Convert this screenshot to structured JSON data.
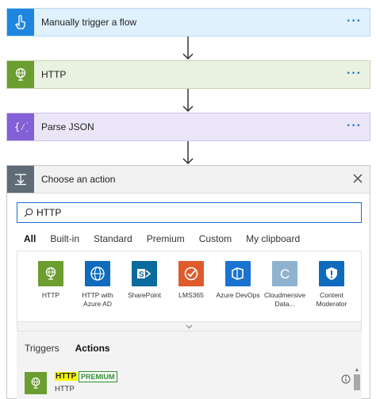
{
  "flow": {
    "steps": [
      {
        "title": "Manually trigger a flow",
        "icon": "hand-touch-icon",
        "color": "#1f86e0"
      },
      {
        "title": "HTTP",
        "icon": "globe-icon",
        "color": "#6b9d2f"
      },
      {
        "title": "Parse JSON",
        "icon": "curly-braces-icon",
        "color": "#8460d6"
      }
    ],
    "more_label": "···"
  },
  "action_picker": {
    "title": "Choose an action",
    "search": {
      "value": "HTTP",
      "placeholder": ""
    },
    "tabs": [
      "All",
      "Built-in",
      "Standard",
      "Premium",
      "Custom",
      "My clipboard"
    ],
    "active_tab": "All",
    "connectors": [
      {
        "label": "HTTP",
        "icon": "globe-icon",
        "color": "#6b9d2f"
      },
      {
        "label": "HTTP with Azure AD",
        "icon": "globe-outline-icon",
        "color": "#0f6cbd"
      },
      {
        "label": "SharePoint",
        "icon": "sharepoint-icon",
        "color": "#0b6a9e"
      },
      {
        "label": "LMS365",
        "icon": "check-circle-icon",
        "color": "#e05b2b"
      },
      {
        "label": "Azure DevOps",
        "icon": "devops-icon",
        "color": "#1a73d1"
      },
      {
        "label": "Cloudmersive Data...",
        "icon": "letter-c-icon",
        "color": "#8fb3cf"
      },
      {
        "label": "Content Moderator",
        "icon": "shield-alert-icon",
        "color": "#0f6cbd"
      }
    ],
    "sub_tabs": [
      "Triggers",
      "Actions"
    ],
    "active_sub_tab": "Actions",
    "result": {
      "name": "HTTP",
      "badge": "PREMIUM",
      "subtitle": "HTTP"
    }
  }
}
